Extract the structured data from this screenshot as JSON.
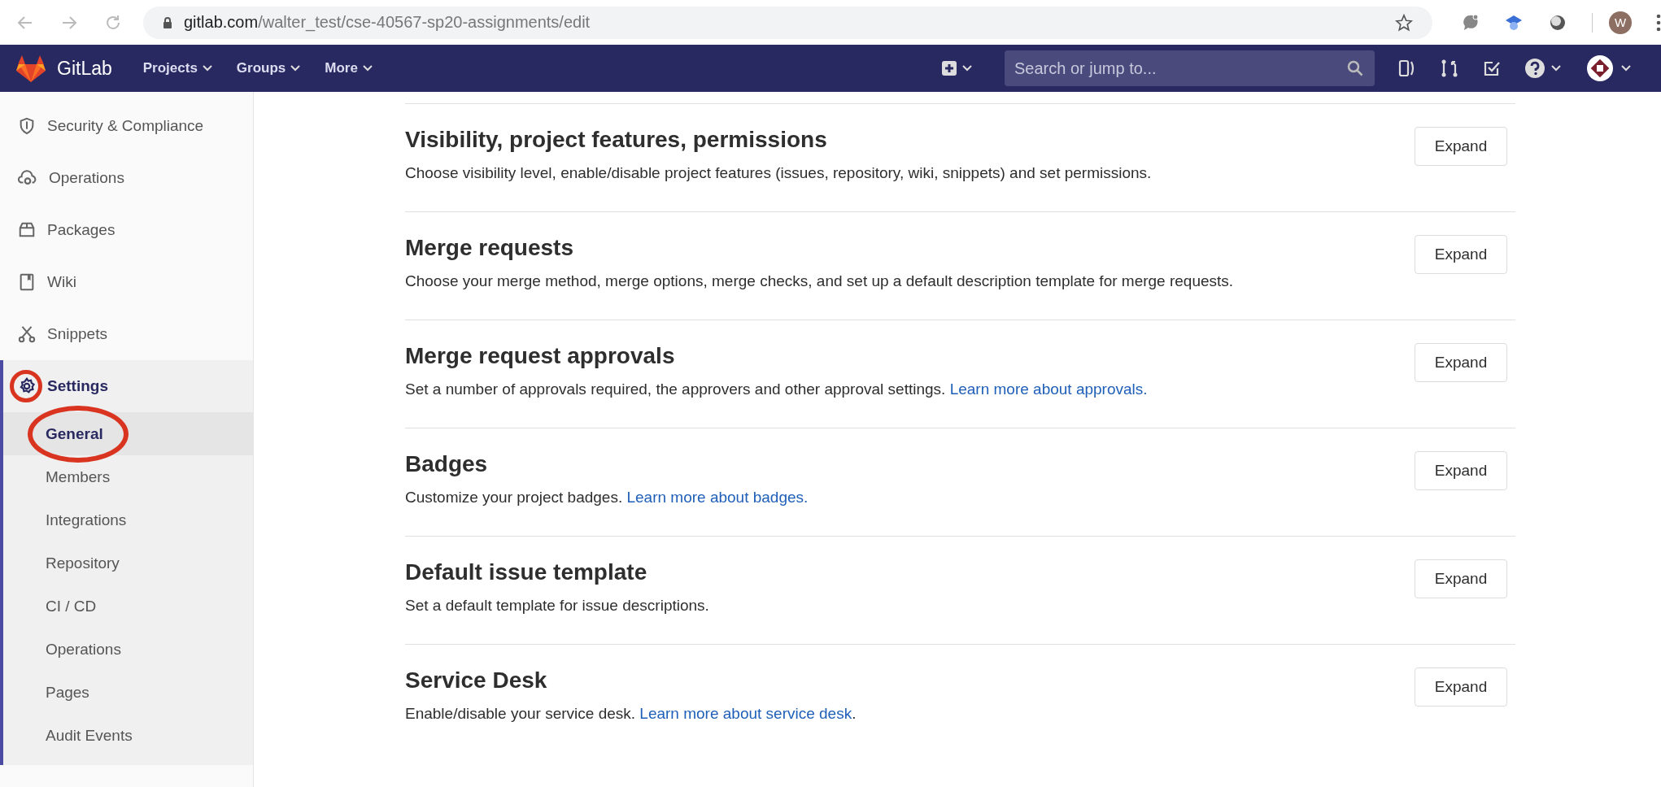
{
  "browser": {
    "url_domain": "gitlab.com",
    "url_path": "/walter_test/cse-40567-sp20-assignments/edit",
    "profile_initial": "W"
  },
  "navbar": {
    "brand": "GitLab",
    "menus": [
      {
        "label": "Projects"
      },
      {
        "label": "Groups"
      },
      {
        "label": "More"
      }
    ],
    "search": {
      "placeholder": "Search or jump to..."
    }
  },
  "sidebar": {
    "items": [
      {
        "label": "Security & Compliance",
        "selected": false,
        "annotated": false
      },
      {
        "label": "Operations",
        "selected": false,
        "annotated": false
      },
      {
        "label": "Packages",
        "selected": false,
        "annotated": false
      },
      {
        "label": "Wiki",
        "selected": false,
        "annotated": false
      },
      {
        "label": "Snippets",
        "selected": false,
        "annotated": false
      },
      {
        "label": "Settings",
        "selected": true,
        "annotated": true,
        "children": [
          {
            "label": "General",
            "selected": true,
            "annotated": true
          },
          {
            "label": "Members",
            "selected": false,
            "annotated": false
          },
          {
            "label": "Integrations",
            "selected": false,
            "annotated": false
          },
          {
            "label": "Repository",
            "selected": false,
            "annotated": false
          },
          {
            "label": "CI / CD",
            "selected": false,
            "annotated": false
          },
          {
            "label": "Operations",
            "selected": false,
            "annotated": false
          },
          {
            "label": "Pages",
            "selected": false,
            "annotated": false
          },
          {
            "label": "Audit Events",
            "selected": false,
            "annotated": false
          }
        ]
      }
    ]
  },
  "sections": [
    {
      "title": "Visibility, project features, permissions",
      "description": "Choose visibility level, enable/disable project features (issues, repository, wiki, snippets) and set permissions.",
      "button": "Expand"
    },
    {
      "title": "Merge requests",
      "description": "Choose your merge method, merge options, merge checks, and set up a default description template for merge requests.",
      "button": "Expand"
    },
    {
      "title": "Merge request approvals",
      "description": "Set a number of approvals required, the approvers and other approval settings.",
      "link": "Learn more about approvals.",
      "button": "Expand"
    },
    {
      "title": "Badges",
      "description": "Customize your project badges.",
      "link": "Learn more about badges.",
      "button": "Expand"
    },
    {
      "title": "Default issue template",
      "description": "Set a default template for issue descriptions.",
      "button": "Expand"
    },
    {
      "title": "Service Desk",
      "description": "Enable/disable your service desk.",
      "link": "Learn more about service desk",
      "after": ".",
      "button": "Expand"
    }
  ]
}
